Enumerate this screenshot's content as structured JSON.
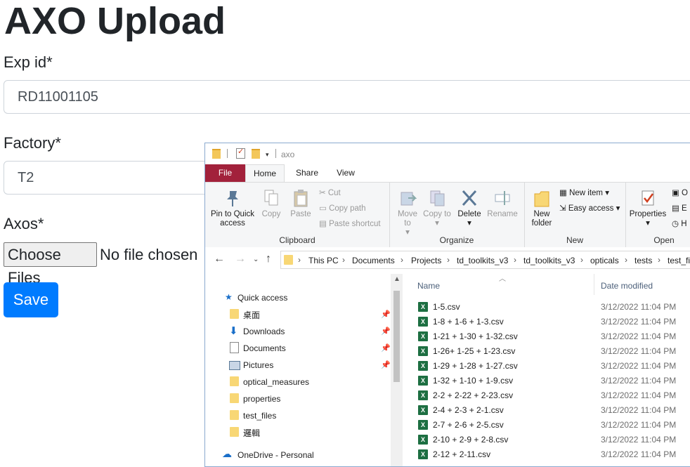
{
  "form": {
    "title": "AXO Upload",
    "exp_id_label": "Exp id*",
    "exp_id_value": "RD11001105",
    "factory_label": "Factory*",
    "factory_value": "T2",
    "axos_label": "Axos*",
    "choose_files_label": "Choose Files",
    "file_status": "No file chosen",
    "save_label": "Save"
  },
  "explorer": {
    "title": "axo",
    "tabs": [
      "File",
      "Home",
      "Share",
      "View"
    ],
    "ribbon": {
      "clipboard": {
        "label": "Clipboard",
        "pin": "Pin to Quick access",
        "copy": "Copy",
        "paste": "Paste",
        "cut": "Cut",
        "copy_path": "Copy path",
        "paste_shortcut": "Paste shortcut"
      },
      "organize": {
        "label": "Organize",
        "move_to": "Move to",
        "copy_to": "Copy to",
        "delete": "Delete",
        "rename": "Rename"
      },
      "new": {
        "label": "New",
        "new_folder": "New folder",
        "new_item": "New item",
        "easy_access": "Easy access"
      },
      "open": {
        "label": "Open",
        "properties": "Properties"
      }
    },
    "breadcrumbs": [
      "This PC",
      "Documents",
      "Projects",
      "td_toolkits_v3",
      "td_toolkits_v3",
      "opticals",
      "tests",
      "test_fi"
    ],
    "nav": {
      "quick_access": "Quick access",
      "items": [
        "桌面",
        "Downloads",
        "Documents",
        "Pictures",
        "optical_measures",
        "properties",
        "test_files",
        "邏輯"
      ],
      "onedrive": "OneDrive - Personal"
    },
    "columns": {
      "name": "Name",
      "date": "Date modified"
    },
    "files": [
      {
        "name": "1-5.csv",
        "date": "3/12/2022 11:04 PM"
      },
      {
        "name": "1-8 + 1-6 + 1-3.csv",
        "date": "3/12/2022 11:04 PM"
      },
      {
        "name": "1-21 + 1-30 + 1-32.csv",
        "date": "3/12/2022 11:04 PM"
      },
      {
        "name": "1-26+ 1-25 + 1-23.csv",
        "date": "3/12/2022 11:04 PM"
      },
      {
        "name": "1-29 + 1-28 + 1-27.csv",
        "date": "3/12/2022 11:04 PM"
      },
      {
        "name": "1-32 + 1-10 + 1-9.csv",
        "date": "3/12/2022 11:04 PM"
      },
      {
        "name": "2-2 + 2-22 + 2-23.csv",
        "date": "3/12/2022 11:04 PM"
      },
      {
        "name": "2-4 + 2-3 + 2-1.csv",
        "date": "3/12/2022 11:04 PM"
      },
      {
        "name": "2-7 + 2-6 + 2-5.csv",
        "date": "3/12/2022 11:04 PM"
      },
      {
        "name": "2-10 + 2-9 + 2-8.csv",
        "date": "3/12/2022 11:04 PM"
      },
      {
        "name": "2-12 + 2-11.csv",
        "date": "3/12/2022 11:04 PM"
      }
    ],
    "colors": {
      "file_tab": "#a2213b",
      "accent": "#007bff",
      "excel": "#1d6f42"
    }
  }
}
